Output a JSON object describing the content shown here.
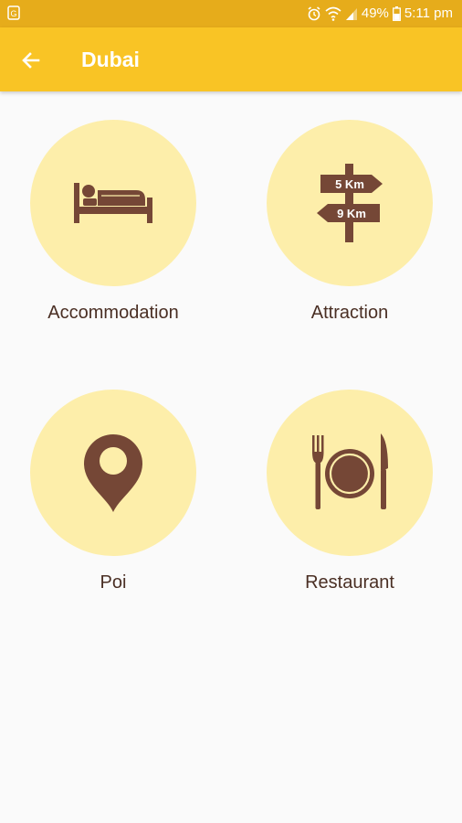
{
  "status_bar": {
    "left_icon": "notification-icon",
    "battery": "49%",
    "time": "5:11 pm"
  },
  "appbar": {
    "title": "Dubai",
    "color": "#f9c425"
  },
  "categories": [
    {
      "label": "Accommodation",
      "icon": "bed-icon"
    },
    {
      "label": "Attraction",
      "icon": "signpost-icon",
      "sign_top": "5 Km",
      "sign_bottom": "9 Km"
    },
    {
      "label": "Poi",
      "icon": "map-pin-icon"
    },
    {
      "label": "Restaurant",
      "icon": "plate-cutlery-icon"
    }
  ],
  "colors": {
    "circle": "#fdeeaa",
    "icon": "#754736",
    "text": "#4a2f24"
  }
}
